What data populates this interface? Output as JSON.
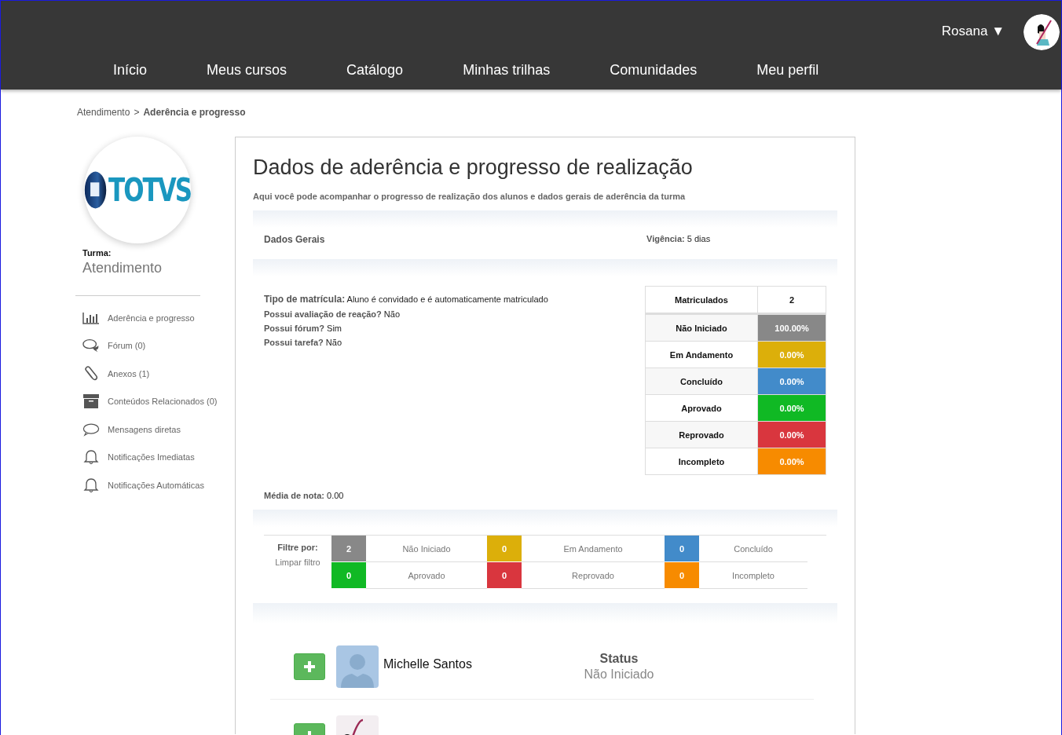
{
  "header": {
    "user_name": "Rosana",
    "user_caret": "▼",
    "nav": [
      {
        "label": "Início"
      },
      {
        "label": "Meus cursos"
      },
      {
        "label": "Catálogo"
      },
      {
        "label": "Minhas trilhas"
      },
      {
        "label": "Comunidades"
      },
      {
        "label": "Meu perfil"
      }
    ]
  },
  "breadcrumb": {
    "items": [
      {
        "label": "Atendimento",
        "current": false
      },
      {
        "label": "Aderência e progresso",
        "current": true
      }
    ],
    "separator": ">"
  },
  "sidebar": {
    "logo_text": "TOTVS",
    "class_label": "Turma:",
    "class_name": "Atendimento",
    "items": [
      {
        "label": "Aderência e progresso",
        "kind": "chart"
      },
      {
        "label": "Fórum (0)",
        "kind": "forum"
      },
      {
        "label": "Anexos (1)",
        "kind": "attachment"
      },
      {
        "label": "Conteúdos Relacionados (0)",
        "kind": "archive"
      },
      {
        "label": "Mensagens diretas",
        "kind": "message"
      },
      {
        "label": "Notificações Imediatas",
        "kind": "notification"
      },
      {
        "label": "Notificações Automáticas",
        "kind": "notification"
      }
    ]
  },
  "main": {
    "title": "Dados de aderência e progresso de realização",
    "subtitle": "Aqui você pode acompanhar o progresso de realização dos alunos e dados gerais de aderência da turma",
    "general_heading": "Dados Gerais",
    "validity_label": "Vigência:",
    "validity_value": "5 dias",
    "facts": [
      {
        "label": "Tipo de matrícula:",
        "value": "Aluno é convidado e é automaticamente matriculado"
      },
      {
        "label": "Possui avaliação de reação?",
        "value": "Não"
      },
      {
        "label": "Possui fórum?",
        "value": "Sim"
      },
      {
        "label": "Possui tarefa?",
        "value": "Não"
      }
    ],
    "enrolled_label": "Matriculados",
    "enrolled_value": "2",
    "statuses": [
      {
        "label": "Não Iniciado",
        "value": "100.00%",
        "color": "#888888"
      },
      {
        "label": "Em Andamento",
        "value": "0.00%",
        "color": "#dcaf0a"
      },
      {
        "label": "Concluído",
        "value": "0.00%",
        "color": "#428bca"
      },
      {
        "label": "Aprovado",
        "value": "0.00%",
        "color": "#10b924"
      },
      {
        "label": "Reprovado",
        "value": "0.00%",
        "color": "#d9363e"
      },
      {
        "label": "Incompleto",
        "value": "0.00%",
        "color": "#f78b00"
      }
    ],
    "average_label": "Média de nota:",
    "average_value": "0.00",
    "filter_label": "Filtre por:",
    "clear_filter": "Limpar filtro",
    "filters": [
      {
        "count": "2",
        "label": "Não Iniciado",
        "color": "#888888"
      },
      {
        "count": "0",
        "label": "Em Andamento",
        "color": "#dcaf0a"
      },
      {
        "count": "0",
        "label": "Concluído",
        "color": "#428bca"
      },
      {
        "count": "0",
        "label": "Aprovado",
        "color": "#10b924"
      },
      {
        "count": "0",
        "label": "Reprovado",
        "color": "#d9363e"
      },
      {
        "count": "0",
        "label": "Incompleto",
        "color": "#f78b00"
      }
    ],
    "students": [
      {
        "name": "Michelle Santos",
        "status_label": "Status",
        "status": "Não Iniciado",
        "kind": "silhouette"
      },
      {
        "kind": "picture"
      }
    ]
  }
}
